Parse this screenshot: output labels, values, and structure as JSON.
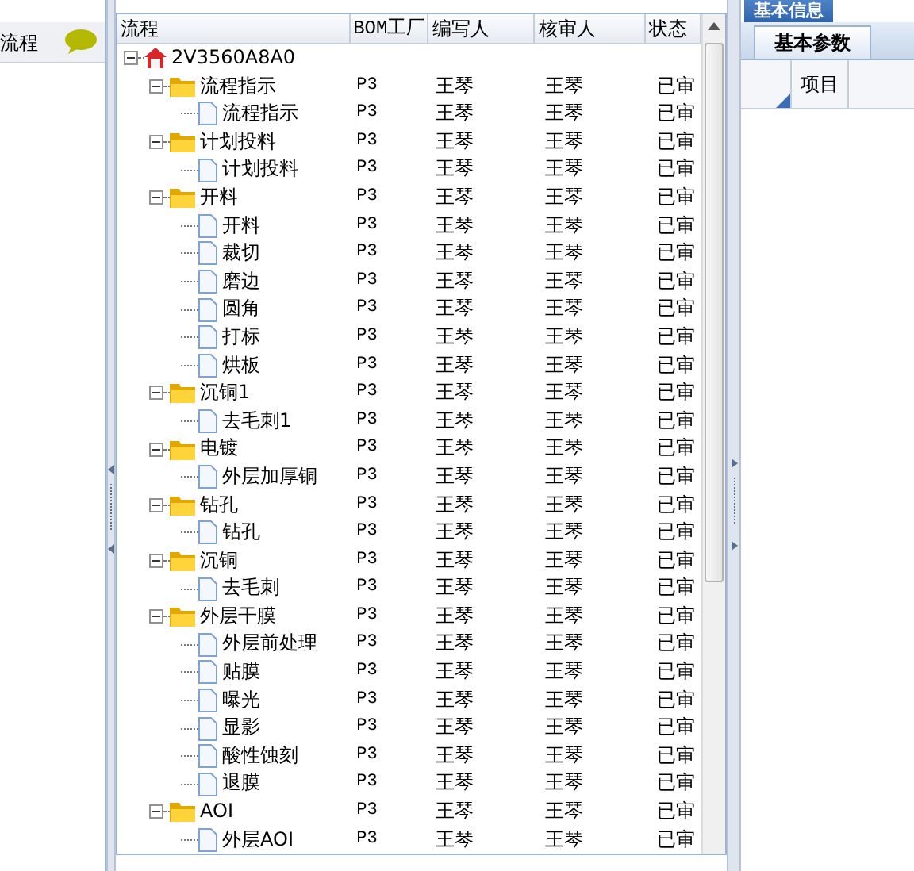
{
  "left_panel": {
    "title": "流程"
  },
  "grid": {
    "columns": [
      "流程",
      "BOM工厂",
      "编写人",
      "核审人",
      "状态"
    ],
    "tree": [
      {
        "kind": "root",
        "name": "2V3560A8A0",
        "expanded": true,
        "children": [
          {
            "kind": "folder",
            "name": "流程指示",
            "expanded": true,
            "cells": [
              "P3",
              "王琴",
              "王琴",
              "已审"
            ],
            "children": [
              {
                "kind": "file",
                "name": "流程指示",
                "cells": [
                  "P3",
                  "王琴",
                  "王琴",
                  "已审"
                ]
              }
            ]
          },
          {
            "kind": "folder",
            "name": "计划投料",
            "expanded": true,
            "cells": [
              "P3",
              "王琴",
              "王琴",
              "已审"
            ],
            "children": [
              {
                "kind": "file",
                "name": "计划投料",
                "cells": [
                  "P3",
                  "王琴",
                  "王琴",
                  "已审"
                ]
              }
            ]
          },
          {
            "kind": "folder",
            "name": "开料",
            "expanded": true,
            "cells": [
              "P3",
              "王琴",
              "王琴",
              "已审"
            ],
            "children": [
              {
                "kind": "file",
                "name": "开料",
                "cells": [
                  "P3",
                  "王琴",
                  "王琴",
                  "已审"
                ]
              },
              {
                "kind": "file",
                "name": "裁切",
                "cells": [
                  "P3",
                  "王琴",
                  "王琴",
                  "已审"
                ]
              },
              {
                "kind": "file",
                "name": "磨边",
                "cells": [
                  "P3",
                  "王琴",
                  "王琴",
                  "已审"
                ]
              },
              {
                "kind": "file",
                "name": "圆角",
                "cells": [
                  "P3",
                  "王琴",
                  "王琴",
                  "已审"
                ]
              },
              {
                "kind": "file",
                "name": "打标",
                "cells": [
                  "P3",
                  "王琴",
                  "王琴",
                  "已审"
                ]
              },
              {
                "kind": "file",
                "name": "烘板",
                "cells": [
                  "P3",
                  "王琴",
                  "王琴",
                  "已审"
                ]
              }
            ]
          },
          {
            "kind": "folder",
            "name": "沉铜1",
            "expanded": true,
            "cells": [
              "P3",
              "王琴",
              "王琴",
              "已审"
            ],
            "children": [
              {
                "kind": "file",
                "name": "去毛刺1",
                "cells": [
                  "P3",
                  "王琴",
                  "王琴",
                  "已审"
                ]
              }
            ]
          },
          {
            "kind": "folder",
            "name": "电镀",
            "expanded": true,
            "cells": [
              "P3",
              "王琴",
              "王琴",
              "已审"
            ],
            "children": [
              {
                "kind": "file",
                "name": "外层加厚铜",
                "cells": [
                  "P3",
                  "王琴",
                  "王琴",
                  "已审"
                ]
              }
            ]
          },
          {
            "kind": "folder",
            "name": "钻孔",
            "expanded": true,
            "cells": [
              "P3",
              "王琴",
              "王琴",
              "已审"
            ],
            "children": [
              {
                "kind": "file",
                "name": "钻孔",
                "cells": [
                  "P3",
                  "王琴",
                  "王琴",
                  "已审"
                ]
              }
            ]
          },
          {
            "kind": "folder",
            "name": "沉铜",
            "expanded": true,
            "cells": [
              "P3",
              "王琴",
              "王琴",
              "已审"
            ],
            "children": [
              {
                "kind": "file",
                "name": "去毛刺",
                "cells": [
                  "P3",
                  "王琴",
                  "王琴",
                  "已审"
                ]
              }
            ]
          },
          {
            "kind": "folder",
            "name": "外层干膜",
            "expanded": true,
            "cells": [
              "P3",
              "王琴",
              "王琴",
              "已审"
            ],
            "children": [
              {
                "kind": "file",
                "name": "外层前处理",
                "cells": [
                  "P3",
                  "王琴",
                  "王琴",
                  "已审"
                ]
              },
              {
                "kind": "file",
                "name": "贴膜",
                "cells": [
                  "P3",
                  "王琴",
                  "王琴",
                  "已审"
                ]
              },
              {
                "kind": "file",
                "name": "曝光",
                "cells": [
                  "P3",
                  "王琴",
                  "王琴",
                  "已审"
                ]
              },
              {
                "kind": "file",
                "name": "显影",
                "cells": [
                  "P3",
                  "王琴",
                  "王琴",
                  "已审"
                ]
              },
              {
                "kind": "file",
                "name": "酸性蚀刻",
                "cells": [
                  "P3",
                  "王琴",
                  "王琴",
                  "已审"
                ]
              },
              {
                "kind": "file",
                "name": "退膜",
                "cells": [
                  "P3",
                  "王琴",
                  "王琴",
                  "已审"
                ]
              }
            ]
          },
          {
            "kind": "folder",
            "name": "AOI",
            "expanded": true,
            "cells": [
              "P3",
              "王琴",
              "王琴",
              "已审"
            ],
            "children": [
              {
                "kind": "file",
                "name": "外层AOI",
                "cells": [
                  "P3",
                  "王琴",
                  "王琴",
                  "已审"
                ]
              }
            ]
          }
        ]
      }
    ]
  },
  "right_panel": {
    "tabs": [
      {
        "label": "基本信息",
        "selected": true
      }
    ],
    "subtabs": [
      {
        "label": "基本参数",
        "selected": true
      }
    ],
    "columns": [
      "项目"
    ]
  }
}
